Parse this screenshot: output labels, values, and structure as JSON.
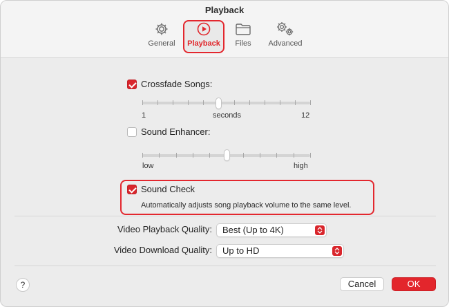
{
  "window": {
    "title": "Playback"
  },
  "tabs": [
    {
      "label": "General",
      "icon": "gear-icon"
    },
    {
      "label": "Playback",
      "icon": "play-circle-icon",
      "active": true
    },
    {
      "label": "Files",
      "icon": "folder-icon"
    },
    {
      "label": "Advanced",
      "icon": "gears-icon"
    }
  ],
  "crossfade": {
    "label": "Crossfade Songs:",
    "checked": true,
    "slider_min_label": "1",
    "slider_mid_label": "seconds",
    "slider_max_label": "12",
    "value": 6
  },
  "sound_enhancer": {
    "label": "Sound Enhancer:",
    "checked": false,
    "slider_min_label": "low",
    "slider_max_label": "high",
    "level": 0.5
  },
  "sound_check": {
    "label": "Sound Check",
    "checked": true,
    "description": "Automatically adjusts song playback volume to the same level."
  },
  "video_playback": {
    "label": "Video Playback Quality:",
    "value": "Best (Up to 4K)"
  },
  "video_download": {
    "label": "Video Download Quality:",
    "value": "Up to HD"
  },
  "footer": {
    "help_label": "?",
    "cancel_label": "Cancel",
    "ok_label": "OK"
  },
  "colors": {
    "accent": "#e3262c",
    "highlight_outline": "#e3272e"
  }
}
